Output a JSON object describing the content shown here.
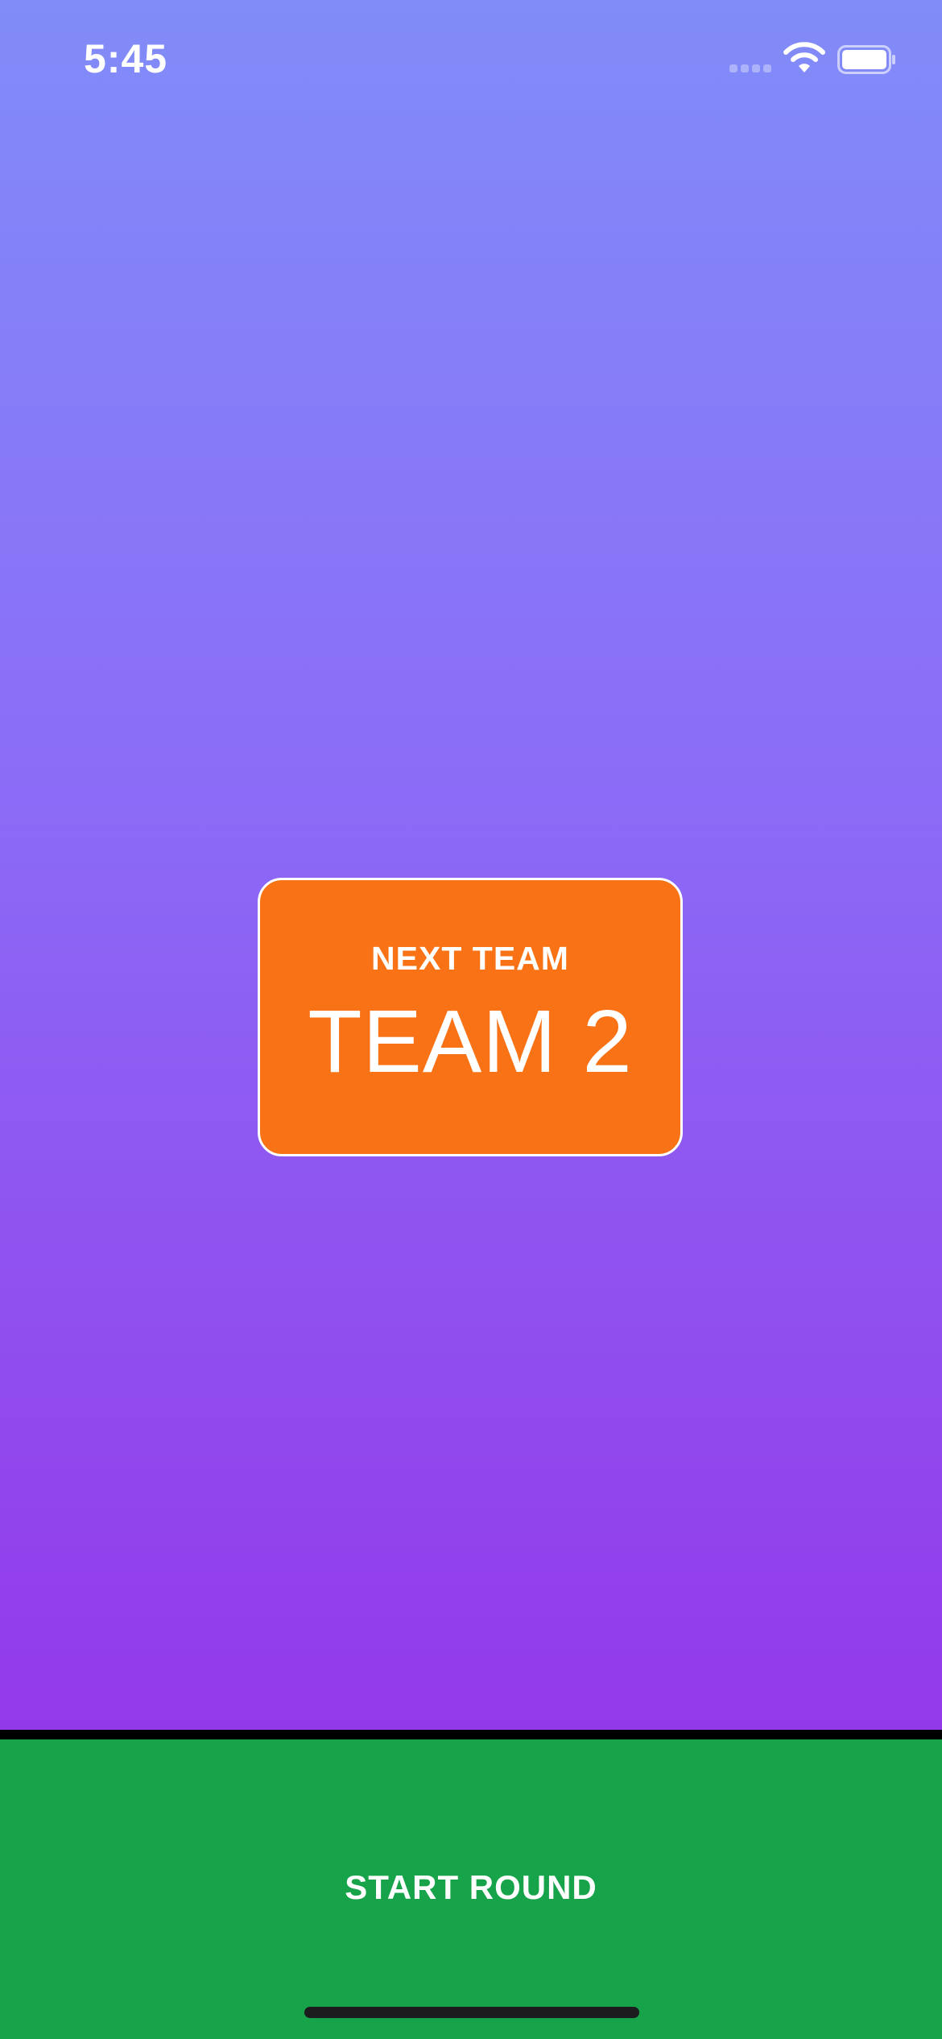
{
  "status_bar": {
    "time": "5:45",
    "icons": [
      "cellular-signal-icon",
      "wifi-icon",
      "battery-icon"
    ]
  },
  "card": {
    "label": "NEXT TEAM",
    "team_name": "TEAM 2"
  },
  "start_button": {
    "label": "START ROUND"
  },
  "colors": {
    "gradient_top": "#818cf8",
    "gradient_bottom": "#9339ea",
    "card_background": "#f97316",
    "card_border": "#ffffff",
    "start_button_background": "#17a34a",
    "divider": "#000000",
    "text": "#ffffff"
  }
}
